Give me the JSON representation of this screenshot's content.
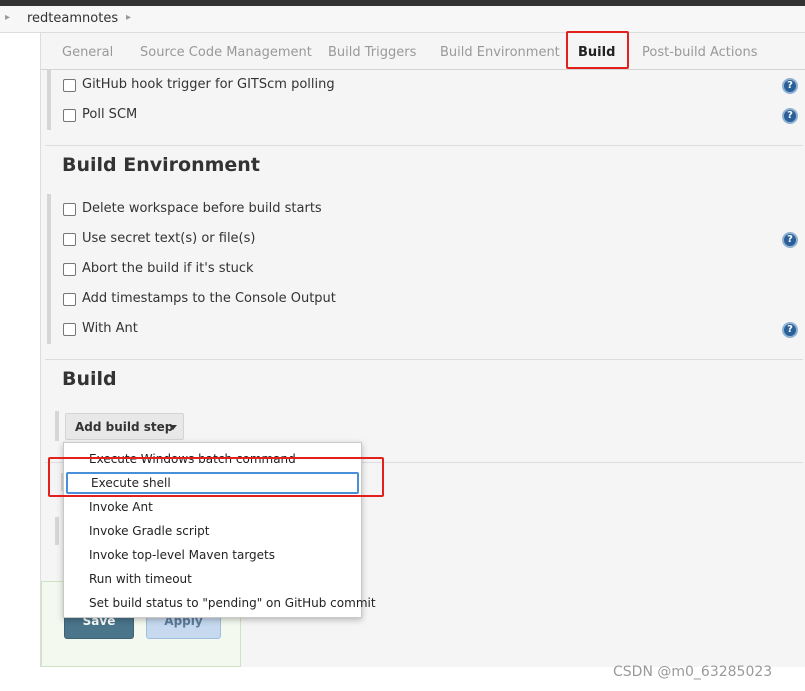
{
  "breadcrumb": {
    "item": "redteamnotes"
  },
  "tabs": [
    {
      "label": "General",
      "active": false
    },
    {
      "label": "Source Code Management",
      "active": false
    },
    {
      "label": "Build Triggers",
      "active": false
    },
    {
      "label": "Build Environment",
      "active": false
    },
    {
      "label": "Build",
      "active": true
    },
    {
      "label": "Post-build Actions",
      "active": false
    }
  ],
  "triggers": [
    {
      "label": "GitHub hook trigger for GITScm polling",
      "checked": false,
      "help": true
    },
    {
      "label": "Poll SCM",
      "checked": false,
      "help": true
    }
  ],
  "build_environment": {
    "title": "Build Environment",
    "options": [
      {
        "label": "Delete workspace before build starts",
        "checked": false,
        "help": false
      },
      {
        "label": "Use secret text(s) or file(s)",
        "checked": false,
        "help": true
      },
      {
        "label": "Abort the build if it's stuck",
        "checked": false,
        "help": false
      },
      {
        "label": "Add timestamps to the Console Output",
        "checked": false,
        "help": false
      },
      {
        "label": "With Ant",
        "checked": false,
        "help": true
      }
    ]
  },
  "build": {
    "title": "Build",
    "add_step_label": "Add build step"
  },
  "build_step_menu": {
    "items": [
      "Execute Windows batch command",
      "Execute shell",
      "Invoke Ant",
      "Invoke Gradle script",
      "Invoke top-level Maven targets",
      "Run with timeout",
      "Set build status to \"pending\" on GitHub commit"
    ],
    "highlighted": "Execute shell"
  },
  "actions": {
    "save_label": "Save",
    "apply_label": "Apply"
  },
  "help_glyph": "?",
  "watermark": "CSDN @m0_63285023",
  "colors": {
    "annotation_red": "#e3201b",
    "save_blue": "#4b758b",
    "apply_blue": "#c6d9ee",
    "help_blue": "#2a6099",
    "hover_blue": "#4a90d9"
  }
}
